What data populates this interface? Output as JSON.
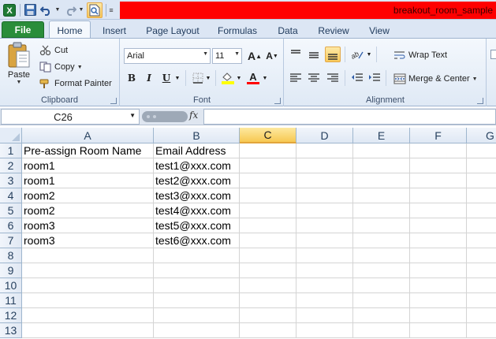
{
  "window": {
    "title": "breakout_room_sample"
  },
  "qat": {
    "icons": [
      "excel-logo-icon",
      "save-icon",
      "undo-icon",
      "redo-icon",
      "print-preview-icon",
      "customize-qat-icon"
    ]
  },
  "tabs": [
    {
      "label": "File"
    },
    {
      "label": "Home"
    },
    {
      "label": "Insert"
    },
    {
      "label": "Page Layout"
    },
    {
      "label": "Formulas"
    },
    {
      "label": "Data"
    },
    {
      "label": "Review"
    },
    {
      "label": "View"
    }
  ],
  "ribbon": {
    "clipboard": {
      "label": "Clipboard",
      "paste": "Paste",
      "cut": "Cut",
      "copy": "Copy",
      "format_painter": "Format Painter"
    },
    "font": {
      "label": "Font",
      "font_name": "Arial",
      "font_size": "11",
      "bold": "B",
      "italic": "I",
      "underline": "U",
      "font_color": "#ff0000",
      "fill_color": "#ffff00"
    },
    "alignment": {
      "label": "Alignment",
      "wrap_text": "Wrap Text",
      "merge_center": "Merge & Center"
    }
  },
  "formula_bar": {
    "name_box": "C26",
    "fx": "fx",
    "value": ""
  },
  "sheet": {
    "columns": [
      "A",
      "B",
      "C",
      "D",
      "E",
      "F",
      "G"
    ],
    "active_column": "C",
    "rows": [
      "1",
      "2",
      "3",
      "4",
      "5",
      "6",
      "7",
      "8",
      "9",
      "10",
      "11",
      "12",
      "13"
    ],
    "cells": [
      [
        "Pre-assign Room Name",
        "Email Address"
      ],
      [
        "room1",
        "test1@xxx.com"
      ],
      [
        "room1",
        "test2@xxx.com"
      ],
      [
        "room2",
        "test3@xxx.com"
      ],
      [
        "room2",
        "test4@xxx.com"
      ],
      [
        "room3",
        "test5@xxx.com"
      ],
      [
        "room3",
        "test6@xxx.com"
      ]
    ]
  },
  "colors": {
    "file_tab": "#2a8d3a",
    "title_bar_highlight": "#ff0000",
    "active_header": "#f7c852"
  }
}
